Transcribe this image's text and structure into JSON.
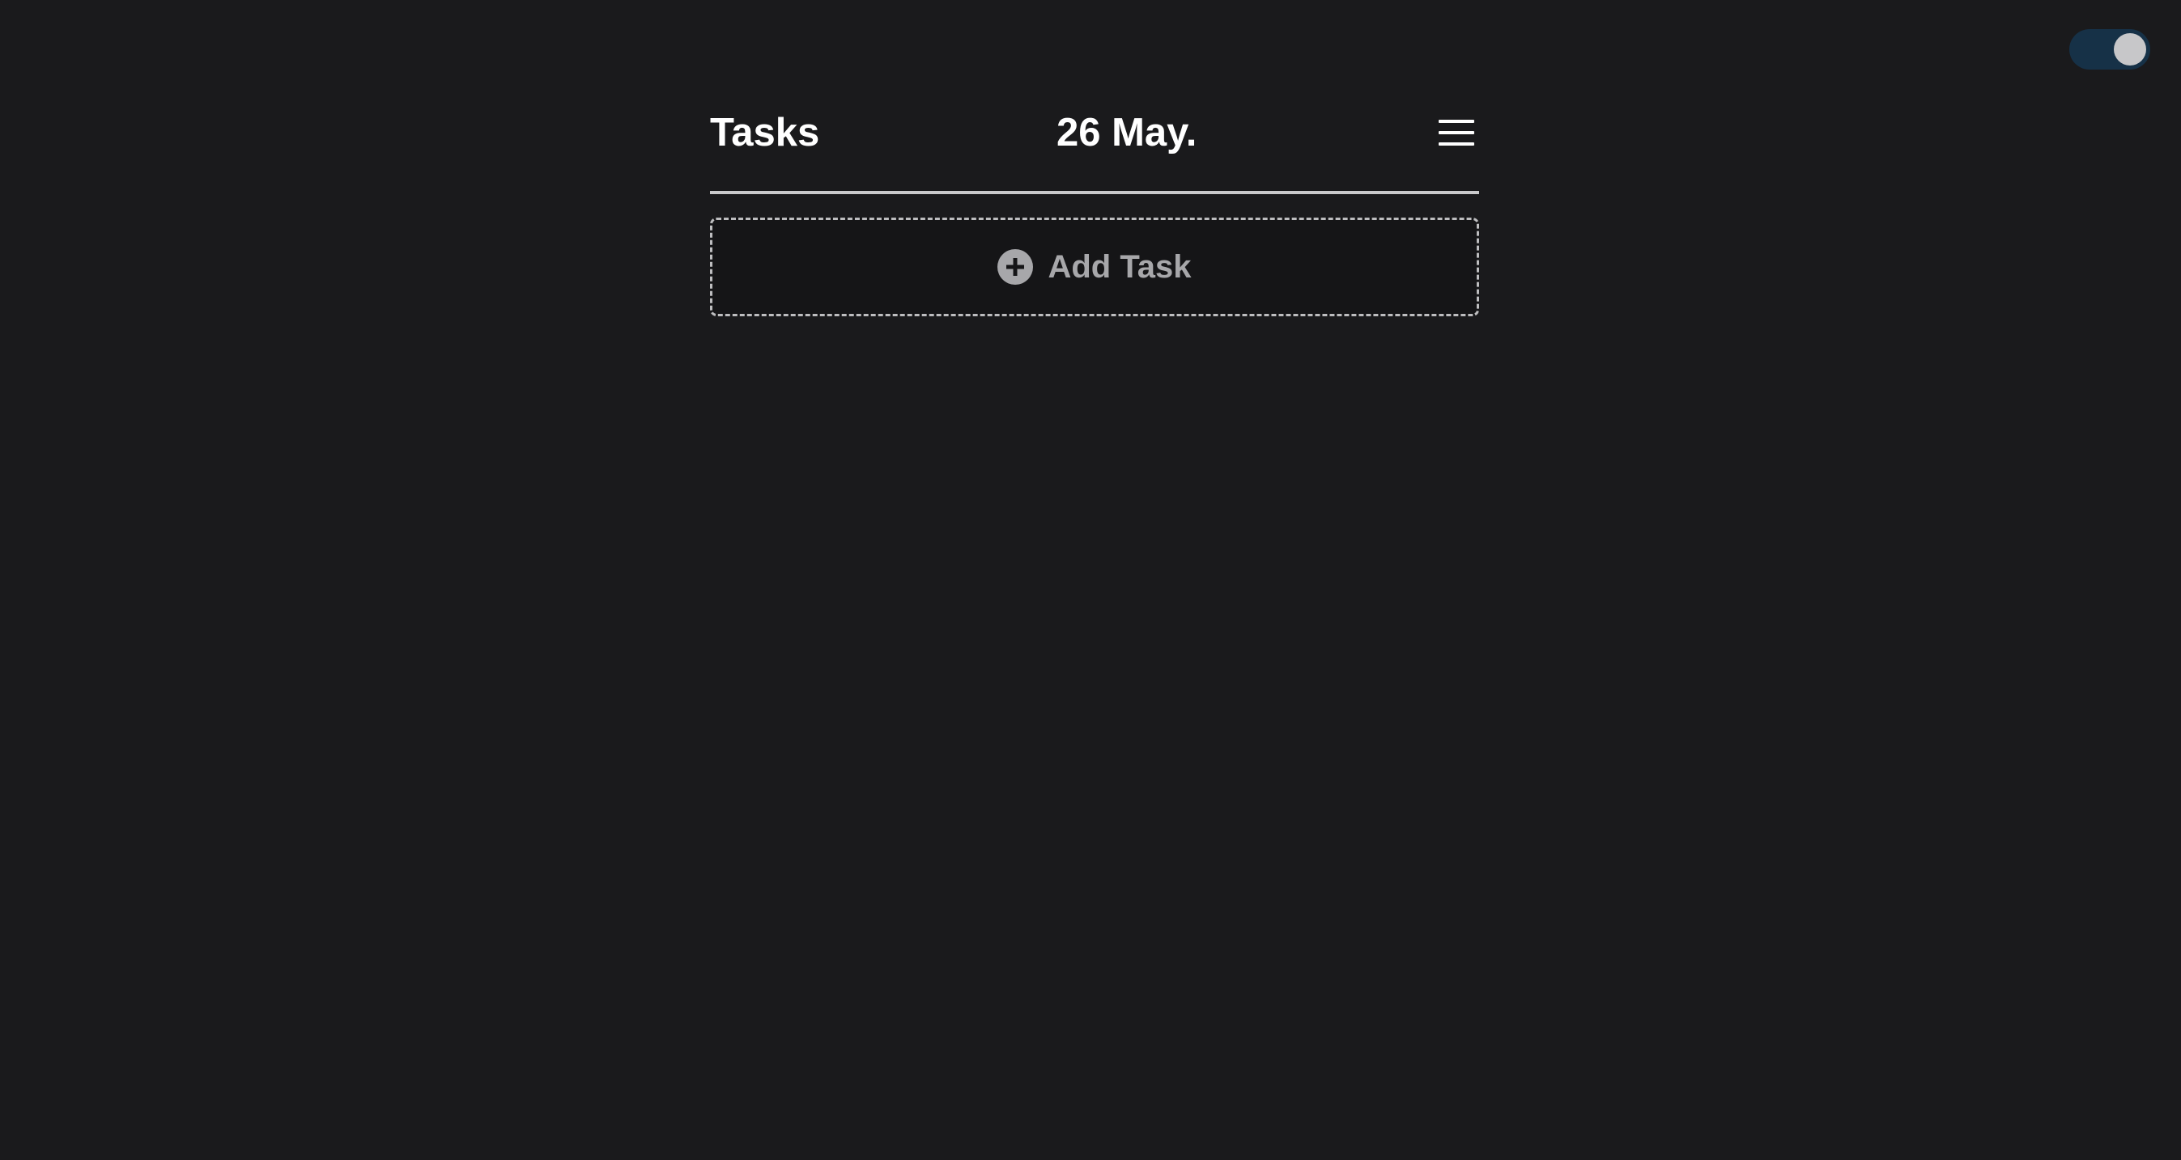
{
  "header": {
    "title": "Tasks",
    "date": "26 May."
  },
  "add_task": {
    "label": "Add Task"
  },
  "theme_toggle": {
    "state": "on"
  },
  "icons": {
    "menu": "hamburger-menu-icon",
    "add": "plus-circle-icon"
  },
  "colors": {
    "background": "#1a1a1c",
    "toggle_track": "#163147",
    "muted_text": "#a7a7aa",
    "divider": "#c9c9cb"
  }
}
